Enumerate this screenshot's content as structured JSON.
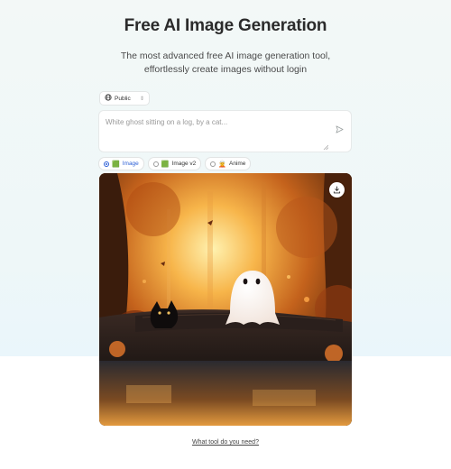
{
  "hero": {
    "title": "Free AI Image Generation",
    "subtitle": "The most advanced free AI image generation tool, effortlessly create images without login"
  },
  "visibility": {
    "label": "Public",
    "icon": "globe-icon"
  },
  "prompt": {
    "value": "",
    "placeholder": "White ghost sitting on a log, by a cat...",
    "send_icon": "send-icon"
  },
  "models": [
    {
      "label": "Image",
      "emoji": "🟩",
      "selected": true
    },
    {
      "label": "Image v2",
      "emoji": "🟩",
      "selected": false
    },
    {
      "label": "Anime",
      "emoji": "🧝",
      "selected": false
    }
  ],
  "image": {
    "download_icon": "download-icon"
  },
  "footer": {
    "link_label": "What tool do you need?"
  },
  "colors": {
    "accent": "#2c5fd6",
    "title": "#2b2b2b"
  }
}
